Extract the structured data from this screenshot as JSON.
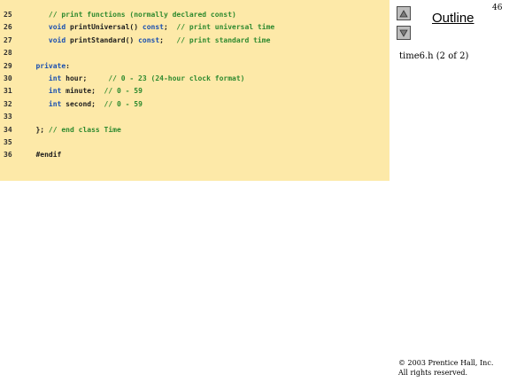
{
  "slide": {
    "page_number": "46",
    "outline_label": "Outline",
    "file_caption": "time6.h (2 of 2)",
    "copyright_line1": "© 2003 Prentice Hall, Inc.",
    "copyright_line2": "All rights reserved."
  },
  "icons": {
    "up": "triangle-up-icon",
    "down": "triangle-down-icon"
  },
  "colors": {
    "panel_background": "#fde9a8",
    "keyword": "#1a4fb0",
    "comment": "#2f8a2f",
    "plain": "#1c1c1c"
  },
  "code": [
    {
      "num": "25",
      "segs": [
        {
          "t": "      // print functions (normally declared const)",
          "c": "comment"
        }
      ]
    },
    {
      "num": "26",
      "segs": [
        {
          "t": "      ",
          "c": "plain"
        },
        {
          "t": "void",
          "c": "kw"
        },
        {
          "t": " printUniversal() ",
          "c": "plain"
        },
        {
          "t": "const",
          "c": "kw"
        },
        {
          "t": ";  ",
          "c": "plain"
        },
        {
          "t": "// print universal time",
          "c": "comment"
        }
      ]
    },
    {
      "num": "27",
      "segs": [
        {
          "t": "      ",
          "c": "plain"
        },
        {
          "t": "void",
          "c": "kw"
        },
        {
          "t": " printStandard() ",
          "c": "plain"
        },
        {
          "t": "const",
          "c": "kw"
        },
        {
          "t": ";   ",
          "c": "plain"
        },
        {
          "t": "// print standard time",
          "c": "comment"
        }
      ]
    },
    {
      "num": "28",
      "segs": []
    },
    {
      "num": "29",
      "segs": [
        {
          "t": "   ",
          "c": "plain"
        },
        {
          "t": "private",
          "c": "kw"
        },
        {
          "t": ":",
          "c": "plain"
        }
      ]
    },
    {
      "num": "30",
      "segs": [
        {
          "t": "      ",
          "c": "plain"
        },
        {
          "t": "int",
          "c": "kw"
        },
        {
          "t": " hour;     ",
          "c": "plain"
        },
        {
          "t": "// 0 - 23 (24-hour clock format)",
          "c": "comment"
        }
      ]
    },
    {
      "num": "31",
      "segs": [
        {
          "t": "      ",
          "c": "plain"
        },
        {
          "t": "int",
          "c": "kw"
        },
        {
          "t": " minute;  ",
          "c": "plain"
        },
        {
          "t": "// 0 - 59",
          "c": "comment"
        }
      ]
    },
    {
      "num": "32",
      "segs": [
        {
          "t": "      ",
          "c": "plain"
        },
        {
          "t": "int",
          "c": "kw"
        },
        {
          "t": " second;  ",
          "c": "plain"
        },
        {
          "t": "// 0 - 59",
          "c": "comment"
        }
      ]
    },
    {
      "num": "33",
      "segs": []
    },
    {
      "num": "34",
      "segs": [
        {
          "t": "   }; ",
          "c": "plain"
        },
        {
          "t": "// end class Time",
          "c": "comment"
        }
      ]
    },
    {
      "num": "35",
      "segs": []
    },
    {
      "num": "36",
      "segs": [
        {
          "t": "   #endif",
          "c": "plain"
        }
      ]
    }
  ]
}
